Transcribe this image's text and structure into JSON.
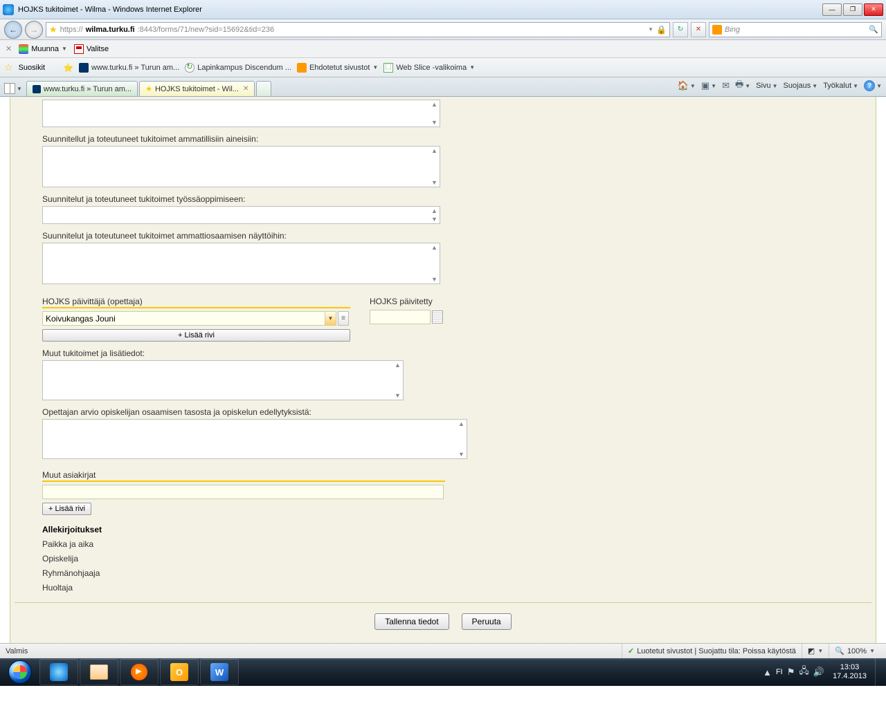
{
  "window": {
    "title": "HOJKS tukitoimet - Wilma - Windows Internet Explorer"
  },
  "nav": {
    "url_prefix": "https://",
    "url_host": "wilma.turku.fi",
    "url_path": ":8443/forms/71/new?sid=15692&tid=236",
    "search_placeholder": "Bing"
  },
  "conv_toolbar": {
    "muunna": "Muunna",
    "valitse": "Valitse"
  },
  "favbar": {
    "suosikit": "Suosikit",
    "turku": "www.turku.fi » Turun am...",
    "lapin": "Lapinkampus Discendum ...",
    "ehdotetut": "Ehdotetut sivustot",
    "slice": "Web Slice -valikoima"
  },
  "tabs": {
    "t1": "www.turku.fi » Turun am...",
    "t2": "HOJKS tukitoimet - Wil..."
  },
  "cmdbar": {
    "sivu": "Sivu",
    "suojaus": "Suojaus",
    "tyokalut": "Työkalut"
  },
  "form": {
    "label_ammatilliset": "Suunnitellut ja toteutuneet tukitoimet ammatillisiin aineisiin:",
    "label_tyossa": "Suunnitelut ja toteutuneet tukitoimet työssäoppimiseen:",
    "label_naytot": "Suunnitelut ja toteutuneet tukitoimet ammattiosaamisen näyttöihin:",
    "label_paivittaja": "HOJKS päivittäjä (opettaja)",
    "label_paivitetty": "HOJKS päivitetty",
    "paivittaja_value": "Koivukangas Jouni",
    "add_row": "+ Lisää rivi",
    "label_muuttuki": "Muut tukitoimet ja lisätiedot:",
    "label_arvio": "Opettajan arvio opiskelijan osaamisen tasosta ja opiskelun edellytyksistä:",
    "label_asiakirjat": "Muut asiakirjat",
    "sig_head": "Allekirjoitukset",
    "sig_paikka": "Paikka ja aika",
    "sig_opiskelija": "Opiskelija",
    "sig_ryhma": "Ryhmänohjaaja",
    "sig_huoltaja": "Huoltaja",
    "btn_save": "Tallenna tiedot",
    "btn_cancel": "Peruuta"
  },
  "status": {
    "left": "Valmis",
    "trusted": "Luotetut sivustot | Suojattu tila: Poissa käytöstä",
    "zoom": "100%"
  },
  "tray": {
    "lang": "FI",
    "time": "13:03",
    "date": "17.4.2013"
  }
}
